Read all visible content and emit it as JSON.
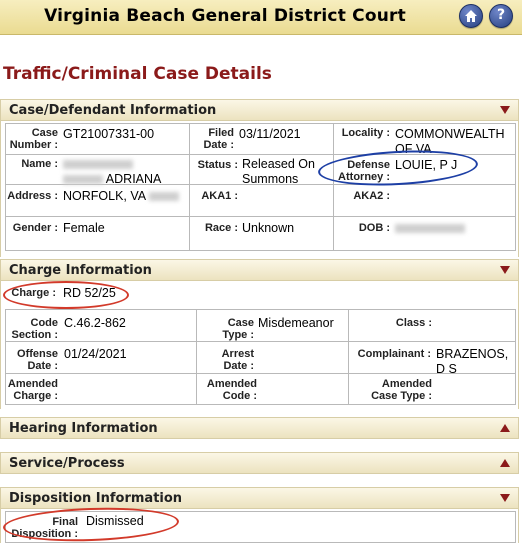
{
  "header": {
    "title": "Virginia Beach General District Court",
    "home_icon": "home-icon",
    "help_icon": "help-icon",
    "help_glyph": "?"
  },
  "page_title": "Traffic/Criminal Case Details",
  "sections": {
    "case": {
      "title": "Case/Defendant Information",
      "case_number_label": "Case Number :",
      "case_number": "GT21007331-00",
      "filed_date_label": "Filed Date :",
      "filed_date": "03/11/2021",
      "locality_label": "Locality :",
      "locality": "COMMONWEALTH OF VA",
      "name_label": "Name :",
      "name_visible": "ADRIANA",
      "status_label": "Status :",
      "status": "Released On Summons",
      "defense_label": "Defense Attorney :",
      "defense_attorney": "LOUIE, P J",
      "address_label": "Address :",
      "address": "NORFOLK, VA",
      "aka1_label": "AKA1 :",
      "aka2_label": "AKA2 :",
      "gender_label": "Gender :",
      "gender": "Female",
      "race_label": "Race :",
      "race": "Unknown",
      "dob_label": "DOB :"
    },
    "charge": {
      "title": "Charge Information",
      "charge_label": "Charge :",
      "charge": "RD 52/25",
      "code_section_label": "Code Section :",
      "code_section": "C.46.2-862",
      "case_type_label": "Case Type :",
      "case_type": "Misdemeanor",
      "class_label": "Class :",
      "offense_date_label": "Offense Date :",
      "offense_date": "01/24/2021",
      "arrest_date_label": "Arrest Date :",
      "complainant_label": "Complainant :",
      "complainant": "BRAZENOS, D S",
      "amended_charge_label": "Amended Charge :",
      "amended_code_label": "Amended Code :",
      "amended_case_type_label": "Amended Case Type :"
    },
    "hearing": {
      "title": "Hearing Information"
    },
    "service": {
      "title": "Service/Process"
    },
    "disposition": {
      "title": "Disposition Information",
      "final_disposition_label": "Final Disposition :",
      "final_disposition": "Dismissed"
    }
  },
  "colors": {
    "header_bg": "#eadb91",
    "page_title": "#8b1a1a",
    "arrow": "#8b1a1a",
    "annotation_red": "#d23a2a",
    "annotation_blue": "#1d3fa5"
  }
}
